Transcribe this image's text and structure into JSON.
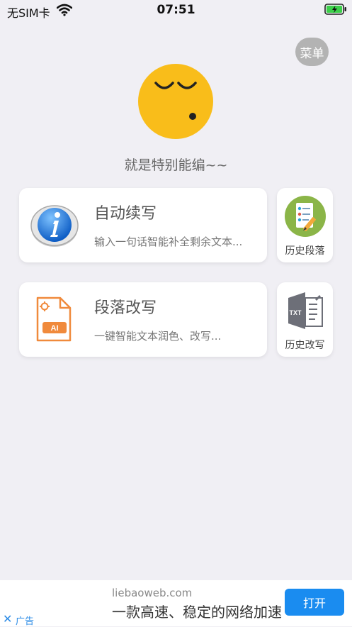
{
  "status_bar": {
    "carrier": "无SIM卡",
    "time": "07:51",
    "wifi_icon": "wifi-icon",
    "battery_icon": "battery-charging-icon"
  },
  "header": {
    "menu_label": "菜单"
  },
  "avatar": {
    "icon": "sleeping-face-icon"
  },
  "tagline": "就是特别能编~~",
  "features": [
    {
      "title": "自动续写",
      "description": "输入一句话智能补全剩余文本...",
      "icon": "info-icon",
      "side_label": "历史段落",
      "side_icon": "checklist-pencil-icon"
    },
    {
      "title": "段落改写",
      "description": "一键智能文本润色、改写...",
      "icon": "ai-file-icon",
      "side_label": "历史改写",
      "side_icon": "txt-document-icon"
    }
  ],
  "ad": {
    "domain": "liebaoweb.com",
    "title": "一款高速、稳定的网络加速",
    "open_label": "打开",
    "tag": "广告",
    "close_symbol": "✕"
  },
  "colors": {
    "background": "#f0eff4",
    "avatar": "#f9bd1a",
    "ad_button": "#1a8cf0",
    "menu_button": "#b3b3b3"
  }
}
